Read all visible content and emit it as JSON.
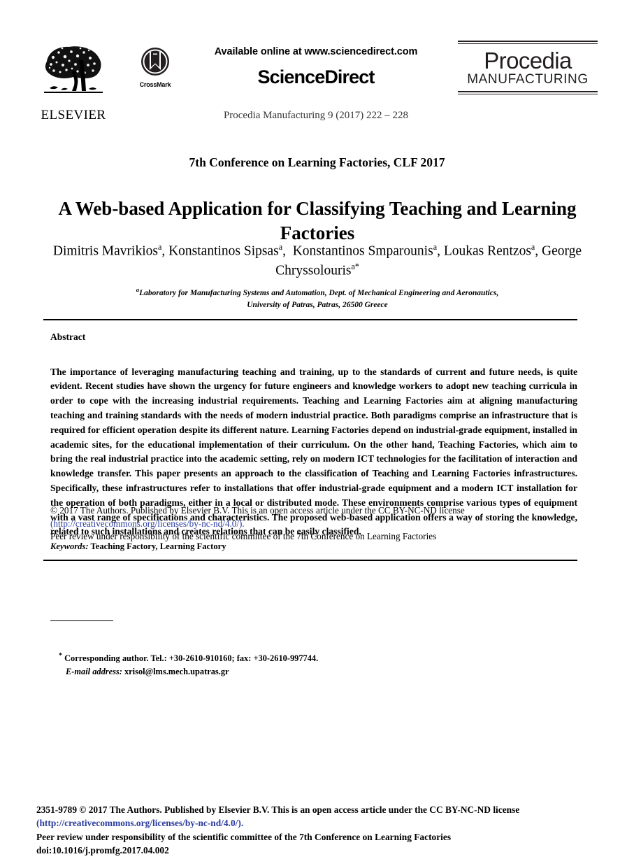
{
  "masthead": {
    "publisher_name": "ELSEVIER",
    "crossmark_label": "CrossMark",
    "available_online": "Available online at www.sciencedirect.com",
    "sciencedirect_logo": "ScienceDirect",
    "journal_reference": "Procedia Manufacturing 9 (2017) 222 – 228",
    "series_name": "Procedia",
    "series_subtitle": "MANUFACTURING"
  },
  "article": {
    "conference": "7th Conference on Learning Factories, CLF 2017",
    "title": "A Web-based Application for Classifying Teaching and Learning Factories",
    "authors": "Dimitris Mavrikios, Konstantinos Sipsas,  Konstantinos Smparounis, Loukas Rentzos, George Chryssolouris",
    "author_list": [
      {
        "name": "Dimitris Mavrikios",
        "affiliation_mark": "a"
      },
      {
        "name": "Konstantinos Sipsas",
        "affiliation_mark": "a"
      },
      {
        "name": "Konstantinos Smparounis",
        "affiliation_mark": "a"
      },
      {
        "name": "Loukas Rentzos",
        "affiliation_mark": "a"
      },
      {
        "name": "George Chryssolouris",
        "affiliation_mark": "a",
        "corresponding_mark": "*"
      }
    ],
    "affiliation_mark": "a",
    "affiliation_line1": "Laboratory for Manufacturing Systems and Automation, Dept. of Mechanical Engineering and Aeronautics,",
    "affiliation_line2": "University of Patras, Patras, 26500 Greece"
  },
  "abstract": {
    "heading": "Abstract",
    "body": "The importance of leveraging manufacturing teaching and training, up to the standards of current and future needs, is quite evident. Recent studies have shown the urgency for future engineers and knowledge workers to adopt new teaching curricula in order to cope with the increasing industrial requirements. Teaching and Learning Factories aim at aligning manufacturing teaching and training standards with the needs of modern industrial practice. Both paradigms comprise an infrastructure that is required for efficient operation despite its different nature. Learning Factories depend on industrial-grade equipment, installed in academic sites, for the educational implementation of their curriculum. On the other hand, Teaching Factories, which aim to bring the real industrial practice into the academic setting, rely on modern ICT technologies for the facilitation of interaction and knowledge transfer. This paper presents an approach to the classification of Teaching and Learning Factories infrastructures. Specifically, these infrastructures refer to installations that offer industrial-grade equipment and a modern ICT installation for the operation of both paradigms, either in a local or distributed mode. These environments comprise various types of equipment with a vast range of specifications and characteristics. The proposed web-based application offers a way of storing the knowledge, related to such installations and creates relations that can be easily classified.",
    "copyright_line": "© 2017 The Authors. Published by Elsevier B.V. This is an open access article under the CC BY-NC-ND license",
    "license_url": "(http://creativecommons.org/licenses/by-nc-nd/4.0/).",
    "peer_review": "Peer review under responsibility of the scientific committee of the 7th Conference on Learning Factories",
    "keywords_label": "Keywords:",
    "keywords_value": " Teaching Factory, Learning Factory"
  },
  "footnote": {
    "marker": "*",
    "corresponding": " Corresponding author. Tel.: +30-2610-910160; fax: +30-2610-997744.",
    "email_label": "E-mail address:",
    "email_value": " xrisol@lms.mech.upatras.gr"
  },
  "footer": {
    "issn_line": "2351-9789 © 2017 The Authors. Published by Elsevier B.V. This is an open access article under the CC BY-NC-ND license",
    "license_url": "(http://creativecommons.org/licenses/by-nc-nd/4.0/).",
    "peer_review": "Peer review under responsibility of the scientific committee of the 7th Conference on Learning Factories",
    "doi": "doi:10.1016/j.promfg.2017.04.002"
  },
  "colors": {
    "text": "#000000",
    "link": "#2b3c9e",
    "brand_dark": "#231f20"
  }
}
